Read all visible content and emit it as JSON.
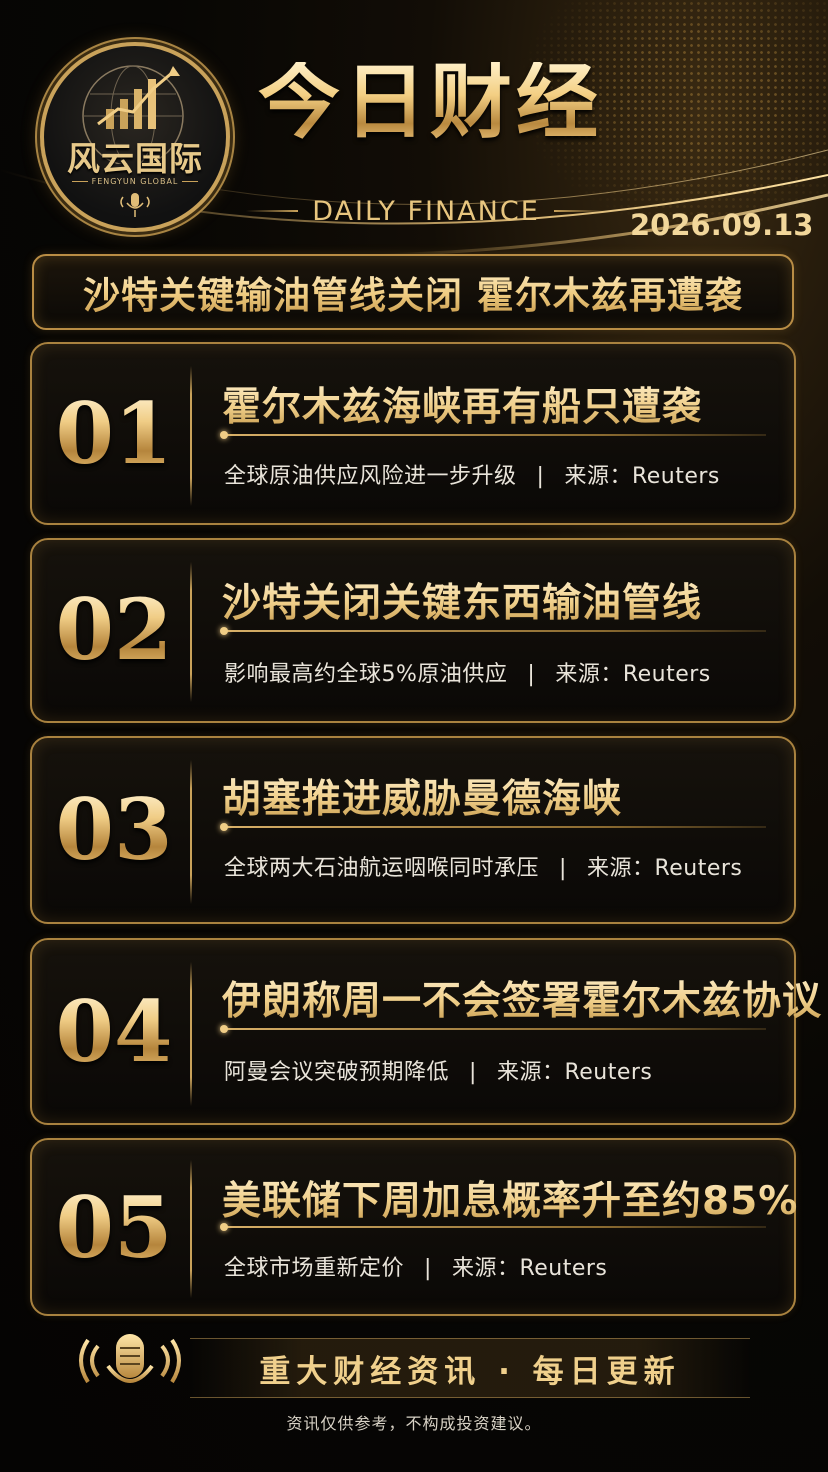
{
  "logo": {
    "name": "风云国际",
    "sub": "FENGYUN GLOBAL"
  },
  "header": {
    "title": "今日财经",
    "subtitle": "DAILY FINANCE",
    "date": "2026.09.13"
  },
  "banner": {
    "text": "沙特关键输油管线关闭 霍尔木兹再遭袭"
  },
  "items": [
    {
      "num": "01",
      "headline": "霍尔木兹海峡再有船只遭袭",
      "detail": "全球原油供应风险进一步升级",
      "sep": "|",
      "source": "来源：Reuters"
    },
    {
      "num": "02",
      "headline": "沙特关闭关键东西输油管线",
      "detail": "影响最高约全球5%原油供应",
      "sep": "|",
      "source": "来源：Reuters"
    },
    {
      "num": "03",
      "headline": "胡塞推进威胁曼德海峡",
      "detail": "全球两大石油航运咽喉同时承压",
      "sep": "|",
      "source": "来源：Reuters"
    },
    {
      "num": "04",
      "headline": "伊朗称周一不会签署霍尔木兹协议",
      "detail": "阿曼会议突破预期降低",
      "sep": "|",
      "source": "来源：Reuters"
    },
    {
      "num": "05",
      "headline": "美联储下周加息概率升至约85%",
      "detail": "全球市场重新定价",
      "sep": "|",
      "source": "来源：Reuters"
    }
  ],
  "footer": {
    "slogan": "重大财经资讯 · 每日更新",
    "disclaimer": "资讯仅供参考，不构成投资建议。"
  },
  "icons": {
    "logo_globe": "globe-icon",
    "logo_mic": "microphone-icon",
    "footer_mic": "podcast-microphone-icon"
  },
  "colors": {
    "gold": "#c9a25a",
    "gold_light": "#f0cd86",
    "background": "#070604"
  }
}
